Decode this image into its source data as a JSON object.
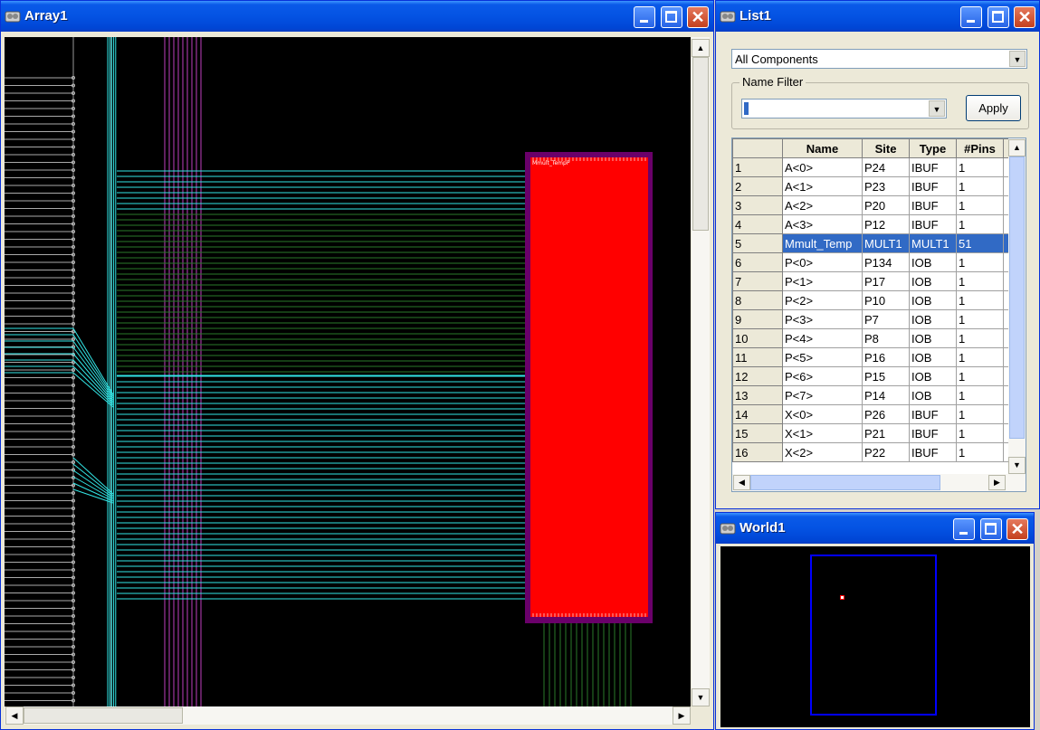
{
  "array_window": {
    "title": "Array1",
    "block_label": "Mmult_TempP",
    "colors": {
      "background": "#000000",
      "net_cyan": "#32e6e6",
      "net_magenta": "#c040c0",
      "net_green": "#2a7a2a",
      "block_fill": "#ff0000",
      "block_border": "#6a006a"
    }
  },
  "list_window": {
    "title": "List1",
    "filter_select": "All Components",
    "name_filter_label": "Name Filter",
    "name_filter_value": "",
    "apply_label": "Apply",
    "columns": [
      "Name",
      "Site",
      "Type",
      "#Pins"
    ],
    "rows": [
      {
        "n": "1",
        "name": "A<0>",
        "site": "P24",
        "type": "IBUF",
        "pins": "1"
      },
      {
        "n": "2",
        "name": "A<1>",
        "site": "P23",
        "type": "IBUF",
        "pins": "1"
      },
      {
        "n": "3",
        "name": "A<2>",
        "site": "P20",
        "type": "IBUF",
        "pins": "1"
      },
      {
        "n": "4",
        "name": "A<3>",
        "site": "P12",
        "type": "IBUF",
        "pins": "1"
      },
      {
        "n": "5",
        "name": "Mmult_Temp",
        "site": "MULT1",
        "type": "MULT1",
        "pins": "51"
      },
      {
        "n": "6",
        "name": "P<0>",
        "site": "P134",
        "type": "IOB",
        "pins": "1"
      },
      {
        "n": "7",
        "name": "P<1>",
        "site": "P17",
        "type": "IOB",
        "pins": "1"
      },
      {
        "n": "8",
        "name": "P<2>",
        "site": "P10",
        "type": "IOB",
        "pins": "1"
      },
      {
        "n": "9",
        "name": "P<3>",
        "site": "P7",
        "type": "IOB",
        "pins": "1"
      },
      {
        "n": "10",
        "name": "P<4>",
        "site": "P8",
        "type": "IOB",
        "pins": "1"
      },
      {
        "n": "11",
        "name": "P<5>",
        "site": "P16",
        "type": "IOB",
        "pins": "1"
      },
      {
        "n": "12",
        "name": "P<6>",
        "site": "P15",
        "type": "IOB",
        "pins": "1"
      },
      {
        "n": "13",
        "name": "P<7>",
        "site": "P14",
        "type": "IOB",
        "pins": "1"
      },
      {
        "n": "14",
        "name": "X<0>",
        "site": "P26",
        "type": "IBUF",
        "pins": "1"
      },
      {
        "n": "15",
        "name": "X<1>",
        "site": "P21",
        "type": "IBUF",
        "pins": "1"
      },
      {
        "n": "16",
        "name": "X<2>",
        "site": "P22",
        "type": "IBUF",
        "pins": "1"
      }
    ],
    "selected_row": "5"
  },
  "world_window": {
    "title": "World1"
  },
  "icons": {
    "window_icon": "app-icon",
    "minimize": "minimize-icon",
    "maximize": "maximize-icon",
    "close": "close-icon",
    "dropdown": "chevron-down-icon"
  }
}
